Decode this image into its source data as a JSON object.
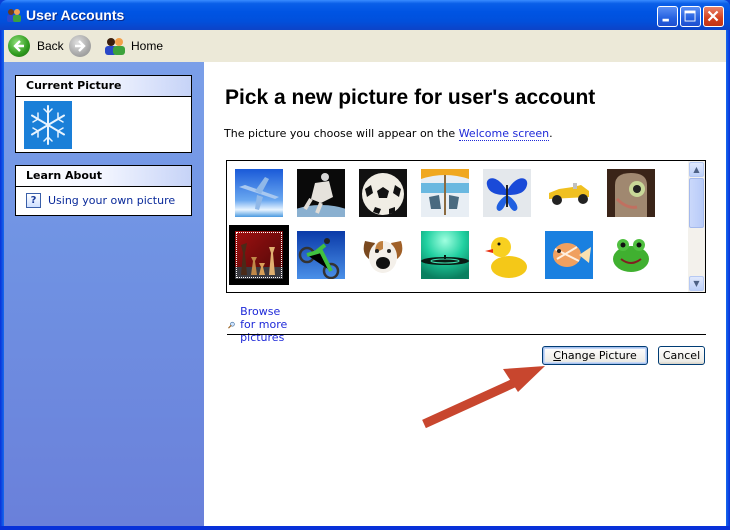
{
  "window": {
    "title": "User Accounts",
    "icon": "user-accounts-icon",
    "controls": {
      "minimize": "minimize-icon",
      "maximize": "maximize-icon",
      "close": "close-icon"
    }
  },
  "toolbar": {
    "back_label": "Back",
    "forward_icon": "forward-arrow-icon",
    "home_label": "Home"
  },
  "sidebar": {
    "current_picture": {
      "heading": "Current Picture",
      "picture": "snowflake"
    },
    "learn_about": {
      "heading": "Learn About",
      "items": [
        {
          "label": "Using your own picture",
          "icon": "help-icon"
        }
      ]
    }
  },
  "main": {
    "heading": "Pick a new picture for user's account",
    "description_prefix": "The picture you choose will appear on the ",
    "description_link": "Welcome screen",
    "description_suffix": ".",
    "pictures": [
      {
        "name": "airplane",
        "selected": false
      },
      {
        "name": "astronaut",
        "selected": false
      },
      {
        "name": "soccer-ball",
        "selected": false
      },
      {
        "name": "beach-chairs",
        "selected": false
      },
      {
        "name": "butterfly",
        "selected": false
      },
      {
        "name": "race-car",
        "selected": false
      },
      {
        "name": "cat",
        "selected": false
      },
      {
        "name": "chess",
        "selected": true
      },
      {
        "name": "dirt-bike",
        "selected": false
      },
      {
        "name": "dog",
        "selected": false
      },
      {
        "name": "drip",
        "selected": false
      },
      {
        "name": "rubber-duck",
        "selected": false
      },
      {
        "name": "fish",
        "selected": false
      },
      {
        "name": "frog",
        "selected": false
      }
    ],
    "browse_label": "Browse for more pictures",
    "change_button": "Change Picture",
    "change_button_mnemonic": "C",
    "cancel_button": "Cancel"
  },
  "annotation": {
    "type": "arrow",
    "color": "#c8462e",
    "points_to": "change-picture-button"
  }
}
